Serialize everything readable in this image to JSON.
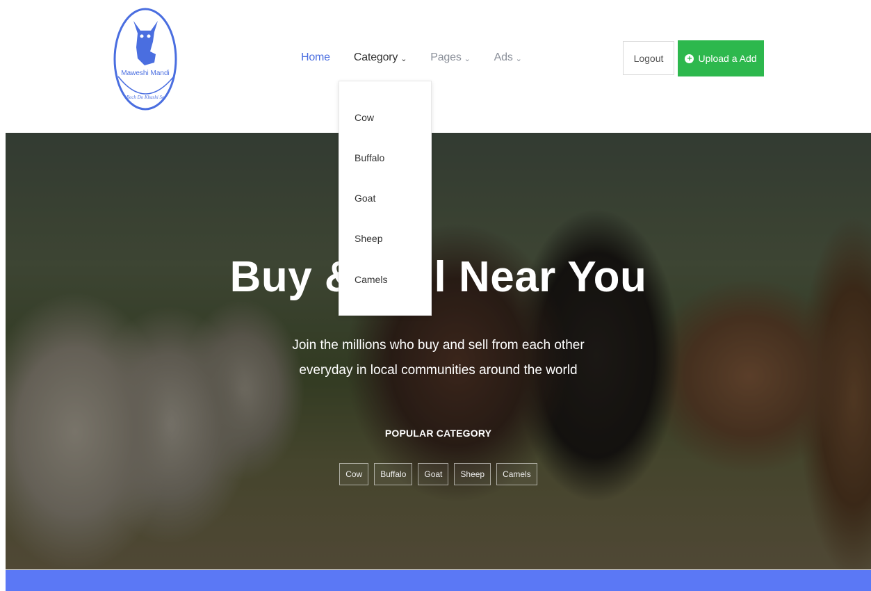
{
  "brand": {
    "name": "Maweshi Mandi",
    "tagline": "Bech Do Khushi Se",
    "accent": "#4a6ee0"
  },
  "nav": {
    "items": [
      {
        "label": "Home",
        "has_dropdown": false,
        "state": "active"
      },
      {
        "label": "Category",
        "has_dropdown": true,
        "state": "open"
      },
      {
        "label": "Pages",
        "has_dropdown": true,
        "state": "default"
      },
      {
        "label": "Ads",
        "has_dropdown": true,
        "state": "default"
      }
    ],
    "logout_label": "Logout",
    "upload_label": "Upload a Add",
    "upload_color": "#2db84d"
  },
  "category_dropdown": {
    "items": [
      "Cow",
      "Buffalo",
      "Goat",
      "Sheep",
      "Camels"
    ]
  },
  "hero": {
    "title": "Buy & Sell Near You",
    "subtitle_line1": "Join the millions who buy and sell from each other",
    "subtitle_line2": "everyday in local communities around the world",
    "popular_title": "POPULAR CATEGORY",
    "popular_tags": [
      "Cow",
      "Buffalo",
      "Goat",
      "Sheep",
      "Camels"
    ]
  },
  "footer_bar_color": "#5b78f5"
}
